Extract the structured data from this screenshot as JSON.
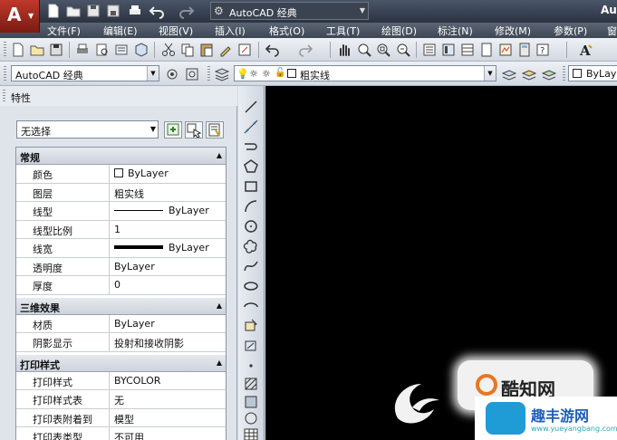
{
  "title_bar": {
    "workspace": "AutoCAD 经典",
    "app_title": "Au"
  },
  "menu": [
    "文件(F)",
    "编辑(E)",
    "视图(V)",
    "插入(I)",
    "格式(O)",
    "工具(T)",
    "绘图(D)",
    "标注(N)",
    "修改(M)",
    "参数(P)",
    "窗"
  ],
  "toolbar2": {
    "workspace": "AutoCAD 经典",
    "layer": "粗实线",
    "color": "ByLay"
  },
  "palette": {
    "title": "特性",
    "close": "✕",
    "selection": "无选择",
    "sections": {
      "general": "常规",
      "three_d": "三维效果",
      "print": "打印样式"
    },
    "general": [
      {
        "key": "颜色",
        "value": "ByLayer"
      },
      {
        "key": "图层",
        "value": "粗实线"
      },
      {
        "key": "线型",
        "value": "ByLayer"
      },
      {
        "key": "线型比例",
        "value": "1"
      },
      {
        "key": "线宽",
        "value": "ByLayer"
      },
      {
        "key": "透明度",
        "value": "ByLayer"
      },
      {
        "key": "厚度",
        "value": "0"
      }
    ],
    "three_d": [
      {
        "key": "材质",
        "value": "ByLayer"
      },
      {
        "key": "阴影显示",
        "value": "投射和接收阴影"
      }
    ],
    "print": [
      {
        "key": "打印样式",
        "value": "BYCOLOR"
      },
      {
        "key": "打印样式表",
        "value": "无"
      },
      {
        "key": "打印表附着到",
        "value": "模型"
      },
      {
        "key": "打印表类型",
        "value": "不可用"
      }
    ]
  },
  "watermarks": {
    "brand1": "酷知网",
    "brand2": "趣丰游网",
    "brand2_url": "www.yueyangbang.com"
  }
}
